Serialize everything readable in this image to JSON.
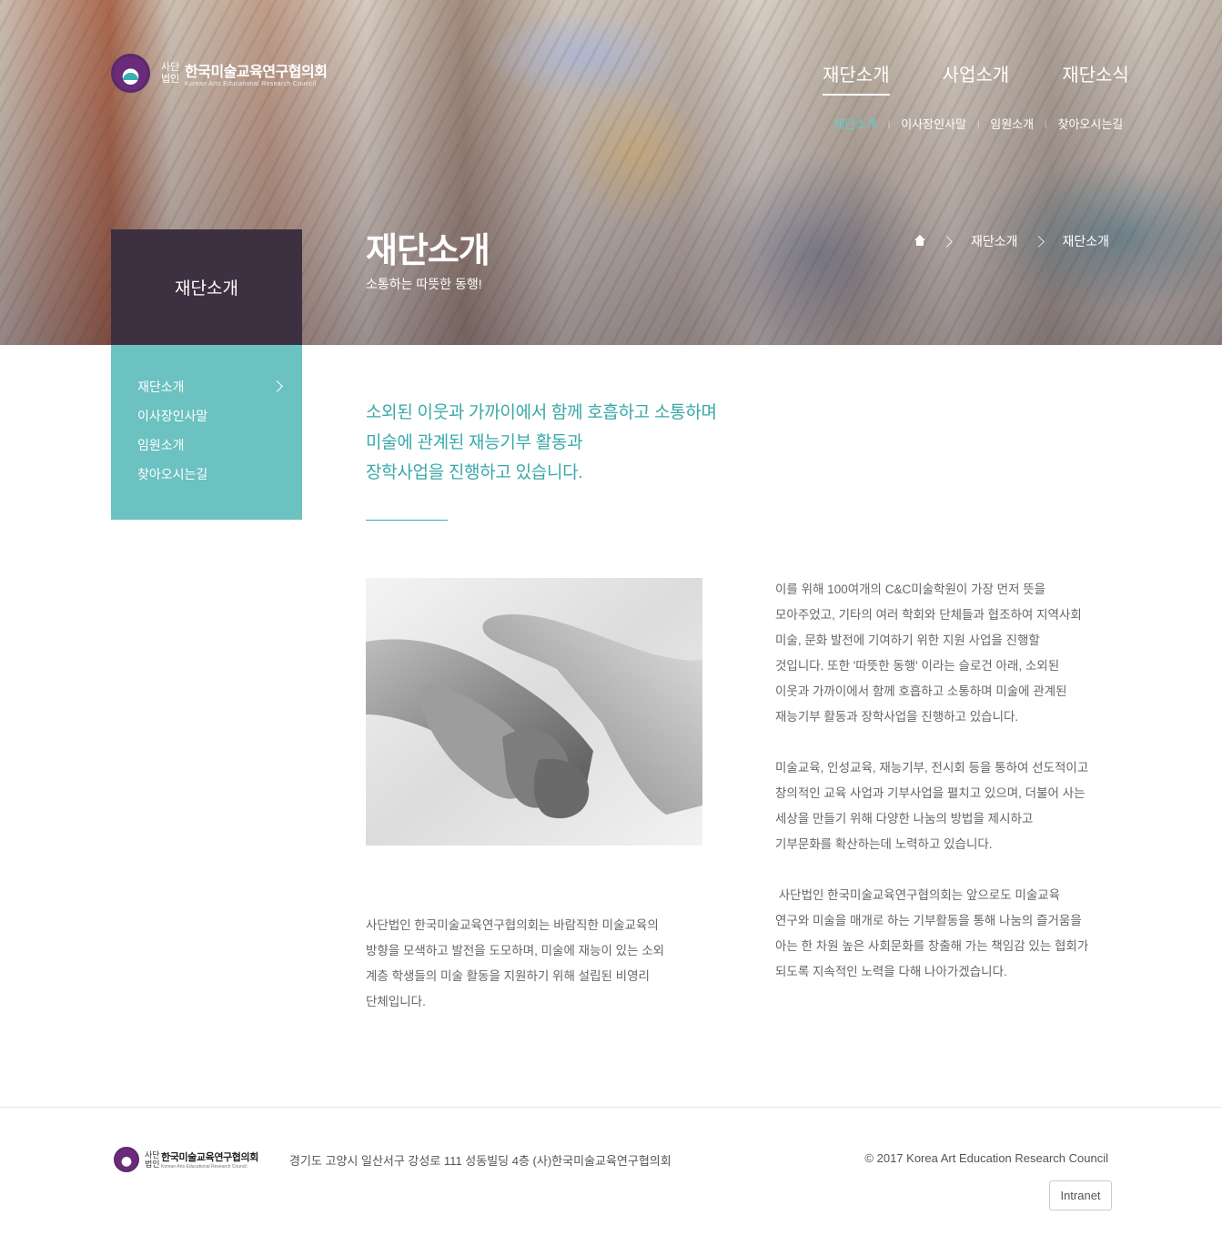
{
  "header": {
    "logo_prefix_1": "사단",
    "logo_prefix_2": "법인",
    "logo_name": "한국미술교육연구협의회",
    "logo_en": "Korean Arts Educational Research Council"
  },
  "gnb": [
    "재단소개",
    "사업소개",
    "재단소식"
  ],
  "subnav": [
    "재단소개",
    "이사장인사말",
    "임원소개",
    "찾아오시는길"
  ],
  "page": {
    "title": "재단소개",
    "subtitle": "소통하는 따뜻한 동행!"
  },
  "breadcrumb": [
    "재단소개",
    "재단소개"
  ],
  "sidebar": {
    "title": "재단소개",
    "items": [
      "재단소개",
      "이사장인사말",
      "임원소개",
      "찾아오시는길"
    ]
  },
  "lead": [
    "소외된 이웃과 가까이에서 함께 호흡하고 소통하며",
    "미술에 관계된 재능기부 활동과",
    "장학사업을 진행하고 있습니다."
  ],
  "body_left": [
    "사단법인 한국미술교육연구협의회는 바람직한 미술교육의",
    "방향을 모색하고 발전을 도모하며, 미술에 재능이 있는 소외",
    "계층 학생들의 미술 활동을 지원하기 위해 설립된 비영리",
    "단체입니다."
  ],
  "body_right": [
    [
      "이를 위해 100여개의 C&C미술학원이 가장 먼저 뜻을",
      "모아주었고, 기타의 여러 학회와 단체들과 협조하여 지역사회",
      "미술, 문화 발전에 기여하기 위한 지원 사업을 진행할",
      "것입니다. 또한 '따뜻한 동행' 이라는 슬로건 아래, 소외된",
      "이웃과 가까이에서 함께 호흡하고 소통하며 미술에 관계된",
      "재능기부 활동과 장학사업을 진행하고 있습니다."
    ],
    [
      "미술교육, 인성교육, 재능기부, 전시회 등을 통하여 선도적이고",
      "창의적인 교육 사업과 기부사업을 펼치고 있으며, 더불어 사는",
      "세상을 만들기 위해 다양한 나눔의 방법을 제시하고",
      "기부문화를 확산하는데 노력하고 있습니다."
    ],
    [
      " 사단법인 한국미술교육연구협의회는 앞으로도 미술교육",
      "연구와 미술을 매개로 하는 기부활동을 통해 나눔의 즐거움을",
      "아는 한 차원 높은 사회문화를 창출해 가는 책임감 있는 협회가",
      "되도록 지속적인 노력을 다해 나아가겠습니다."
    ]
  ],
  "footer": {
    "logo_prefix_1": "사단",
    "logo_prefix_2": "법인",
    "logo_name": "한국미술교육연구협의회",
    "logo_en": "Korean Arts Educational Research Council",
    "address": "경기도 고양시 일산서구 강성로 111 성동빌딩 4층 (사)한국미술교육연구협의회",
    "copyright": "© 2017 Korea Art Education Research Council",
    "intranet": "Intranet"
  },
  "colors": {
    "accent": "#6cc1c1",
    "accent_text": "#3aa8a8",
    "sidebar_head": "#3d3040",
    "active_subnav": "#5fd0cd"
  },
  "icons": [
    "home-icon",
    "chevron-right-icon"
  ]
}
